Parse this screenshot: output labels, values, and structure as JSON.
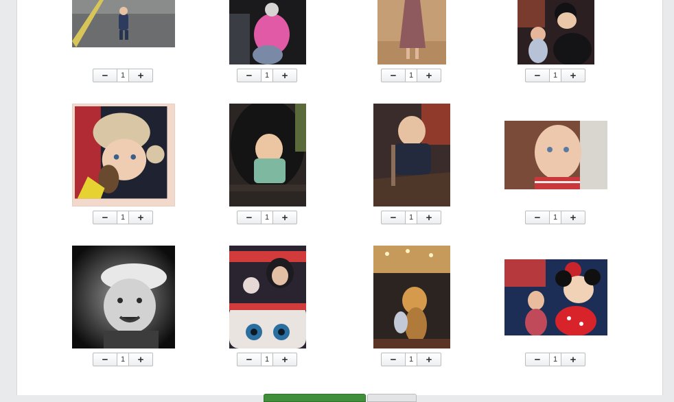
{
  "photos": [
    {
      "name": "photo-child-walking-road",
      "quantity": "1"
    },
    {
      "name": "photo-child-pink-coat",
      "quantity": "1"
    },
    {
      "name": "photo-child-floral-dress",
      "quantity": "1"
    },
    {
      "name": "photo-girl-with-mouse-character",
      "quantity": "1"
    },
    {
      "name": "photo-baby-fur-hat",
      "quantity": "1"
    },
    {
      "name": "photo-baby-in-pushchair",
      "quantity": "1"
    },
    {
      "name": "photo-baby-in-highchair",
      "quantity": "1"
    },
    {
      "name": "photo-baby-closeup",
      "quantity": "1"
    },
    {
      "name": "photo-baby-flat-cap-bw",
      "quantity": "1"
    },
    {
      "name": "photo-fairground-ride",
      "quantity": "1"
    },
    {
      "name": "photo-girl-with-dog-character",
      "quantity": "1"
    },
    {
      "name": "photo-girl-with-minnie-character",
      "quantity": "1"
    }
  ],
  "stepper": {
    "minus": "−",
    "plus": "+"
  },
  "colors": {
    "primary_button": "#3f8f3a",
    "secondary_button": "#e3e4e6"
  }
}
